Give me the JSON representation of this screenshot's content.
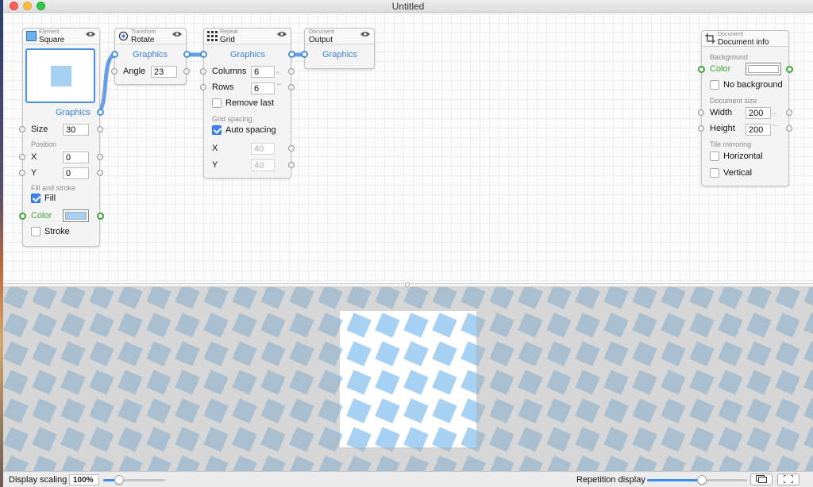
{
  "window": {
    "title": "Untitled"
  },
  "colors": {
    "accent": "#3b82f0",
    "port_blue": "#4a8fe0",
    "fill_color": "#a7d1f3",
    "port_green": "#3aa33a"
  },
  "nodes": {
    "square": {
      "category": "Element",
      "name": "Square",
      "output_label": "Graphics",
      "size_label": "Size",
      "size_value": "30",
      "position_section": "Position",
      "x_label": "X",
      "x_value": "0",
      "y_label": "Y",
      "y_value": "0",
      "fill_section": "Fill and stroke",
      "fill_label": "Fill",
      "fill_checked": true,
      "color_label": "Color",
      "stroke_label": "Stroke",
      "stroke_checked": false
    },
    "rotate": {
      "category": "Transform",
      "name": "Rotate",
      "input_label": "Graphics",
      "angle_label": "Angle",
      "angle_value": "23"
    },
    "grid": {
      "category": "Repeat",
      "name": "Grid",
      "input_label": "Graphics",
      "columns_label": "Columns",
      "columns_value": "6",
      "rows_label": "Rows",
      "rows_value": "6",
      "remove_last_label": "Remove last",
      "remove_last_checked": false,
      "spacing_section": "Grid spacing",
      "auto_spacing_label": "Auto spacing",
      "auto_spacing_checked": true,
      "x_label": "X",
      "x_value": "40",
      "y_label": "Y",
      "y_value": "40"
    },
    "output": {
      "category": "Document",
      "name": "Output",
      "input_label": "Graphics"
    },
    "docinfo": {
      "category": "Document",
      "name": "Document info",
      "background_section": "Background",
      "color_label": "Color",
      "no_background_label": "No background",
      "no_background_checked": false,
      "size_section": "Document size",
      "width_label": "Width",
      "width_value": "200",
      "height_label": "Height",
      "height_value": "200",
      "mirroring_section": "Tile mirroring",
      "horizontal_label": "Horizontal",
      "vertical_label": "Vertical"
    }
  },
  "statusbar": {
    "display_scaling_label": "Display scaling",
    "display_scaling_value": "100%",
    "display_scaling_fraction": 0.25,
    "repetition_label": "Repetition display",
    "repetition_fraction": 0.55
  }
}
